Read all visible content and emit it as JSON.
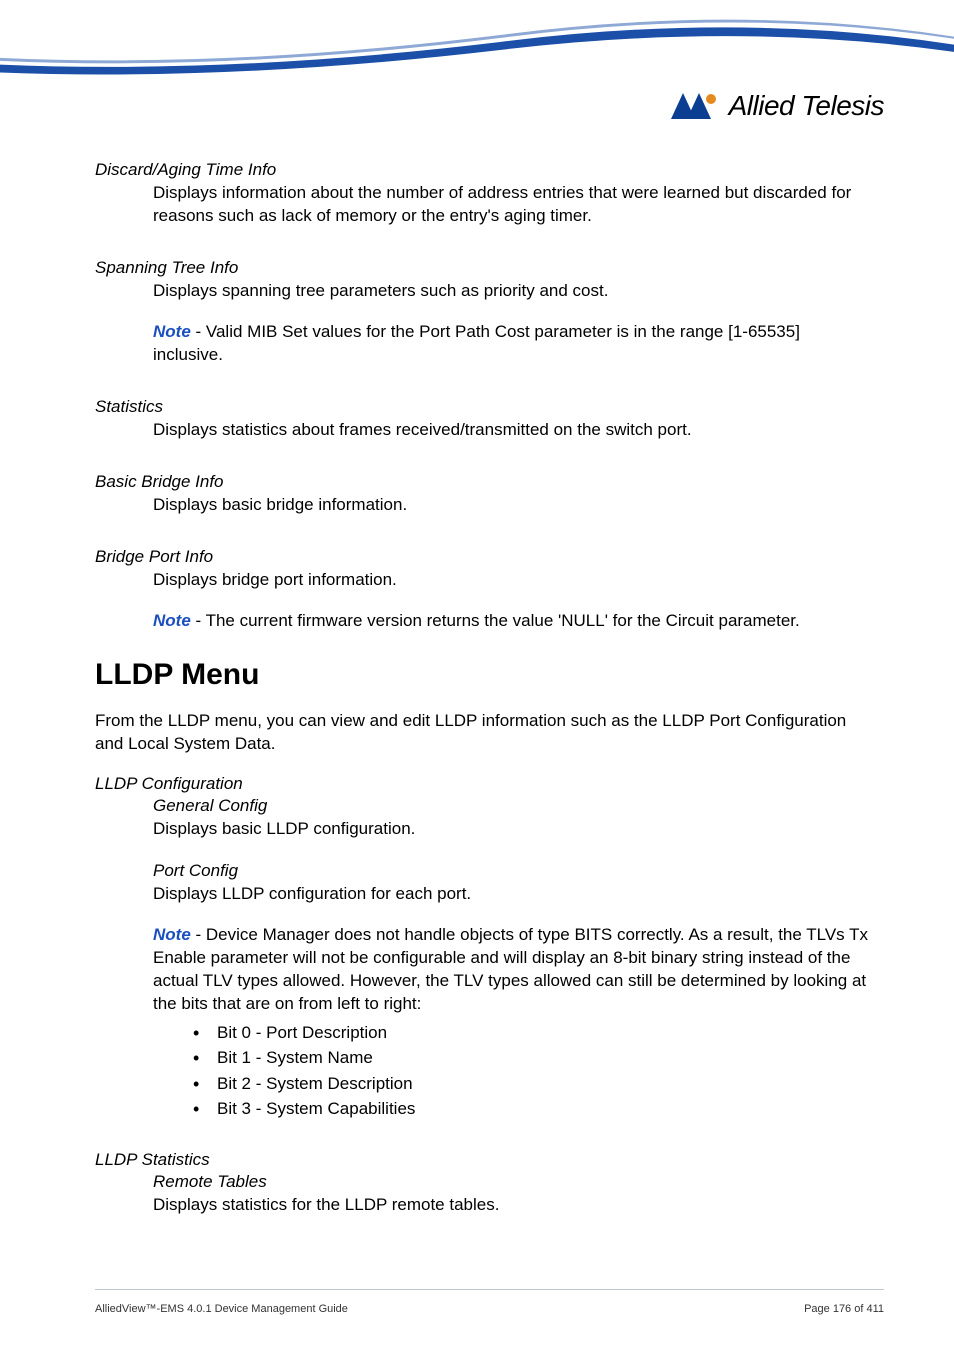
{
  "logo": {
    "brand": "Allied Telesis"
  },
  "sections": {
    "discard": {
      "title": "Discard/Aging Time Info",
      "body": "Displays information about the number of address entries that were learned but discarded for reasons such as lack of memory or the entry's aging timer."
    },
    "spanning": {
      "title": "Spanning Tree Info",
      "body": "Displays spanning tree parameters such as priority and cost.",
      "note_label": "Note",
      "note": " - Valid MIB Set values for the Port Path Cost parameter is in the range [1-65535] inclusive."
    },
    "statistics": {
      "title": "Statistics",
      "body": "Displays statistics about frames received/transmitted on the switch port."
    },
    "basic_bridge": {
      "title": "Basic Bridge Info",
      "body": "Displays basic bridge information."
    },
    "bridge_port": {
      "title": "Bridge Port Info",
      "body": "Displays bridge port information.",
      "note_label": "Note",
      "note": " - The current firmware version returns the value 'NULL' for the Circuit parameter."
    }
  },
  "lldp": {
    "heading": "LLDP Menu",
    "intro": "From the LLDP menu, you can view and edit LLDP information such as the LLDP Port Configuration and Local System Data.",
    "config": {
      "title": "LLDP Configuration",
      "general": {
        "title": "General Config",
        "body": "Displays basic LLDP configuration."
      },
      "port": {
        "title": "Port Config",
        "body": "Displays LLDP configuration for each port."
      },
      "note_label": "Note",
      "note": " - Device Manager does not handle objects of type BITS correctly. As a result, the TLVs Tx Enable parameter will not be configurable and will display an 8-bit binary string instead of the actual TLV types allowed. However, the TLV types allowed can still be determined by looking at the bits that are on from left to right:",
      "bits": [
        "Bit 0 - Port Description",
        "Bit 1 - System Name",
        "Bit 2 - System Description",
        "Bit 3 - System Capabilities"
      ]
    },
    "stats": {
      "title": "LLDP Statistics",
      "remote": {
        "title": "Remote Tables",
        "body": "Displays statistics for the LLDP remote tables."
      }
    }
  },
  "footer": {
    "left": "AlliedView™-EMS 4.0.1 Device Management Guide",
    "right": "Page 176 of 411"
  }
}
